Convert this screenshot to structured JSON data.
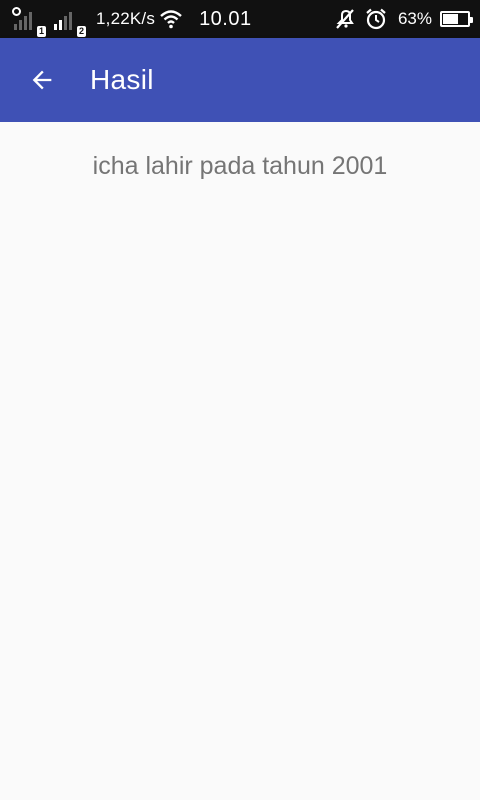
{
  "status_bar": {
    "sim1_label": "1",
    "sim2_label": "2",
    "network_speed": "1,22K/s",
    "time": "10.01",
    "battery_percent": "63%",
    "battery_level": 0.63,
    "icons": [
      "signal-icon",
      "wifi-icon",
      "mute-icon",
      "alarm-icon",
      "battery-icon"
    ]
  },
  "app_bar": {
    "title": "Hasil",
    "background_color": "#3f51b5",
    "back_icon": "arrow-back-icon"
  },
  "main": {
    "result_text": "icha lahir pada tahun 2001"
  }
}
